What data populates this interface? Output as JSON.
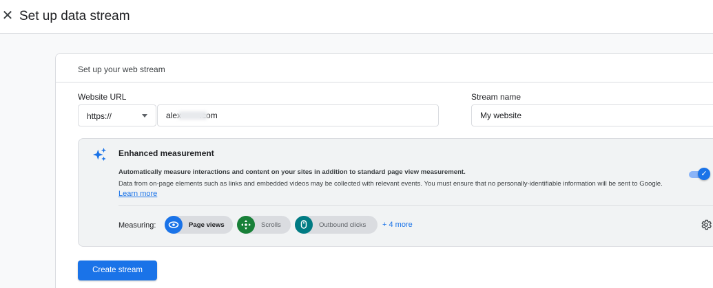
{
  "header": {
    "close_icon": "close-icon",
    "title": "Set up data stream"
  },
  "card": {
    "heading": "Set up your web stream",
    "website_url": {
      "label": "Website URL",
      "protocol": "https://",
      "protocol_icon": "chevron-down-icon",
      "value": "alex        .com"
    },
    "stream_name": {
      "label": "Stream name",
      "value": "My website"
    },
    "enhanced_measurement": {
      "icon": "sparkle-icon",
      "title": "Enhanced measurement",
      "bold_text": "Automatically measure interactions and content on your sites in addition to standard page view measurement.",
      "description": "Data from on-page elements such as links and embedded videos may be collected with relevant events. You must ensure that no personally-identifiable information will be sent to Google.",
      "learn_more": "Learn more",
      "toggle_on": true,
      "measuring_label": "Measuring:",
      "chips": [
        {
          "label": "Page views",
          "icon": "eye-icon",
          "color": "#1a73e8"
        },
        {
          "label": "Scrolls",
          "icon": "crosshair-icon",
          "color": "#188038"
        },
        {
          "label": "Outbound clicks",
          "icon": "mouse-icon",
          "color": "#007b83"
        }
      ],
      "more_link": "+ 4 more",
      "settings_icon": "gear-icon"
    },
    "create_button": "Create stream"
  },
  "colors": {
    "accent": "#1a73e8",
    "page_bg": "#f8f9fa",
    "panel_bg": "#f1f3f4"
  }
}
